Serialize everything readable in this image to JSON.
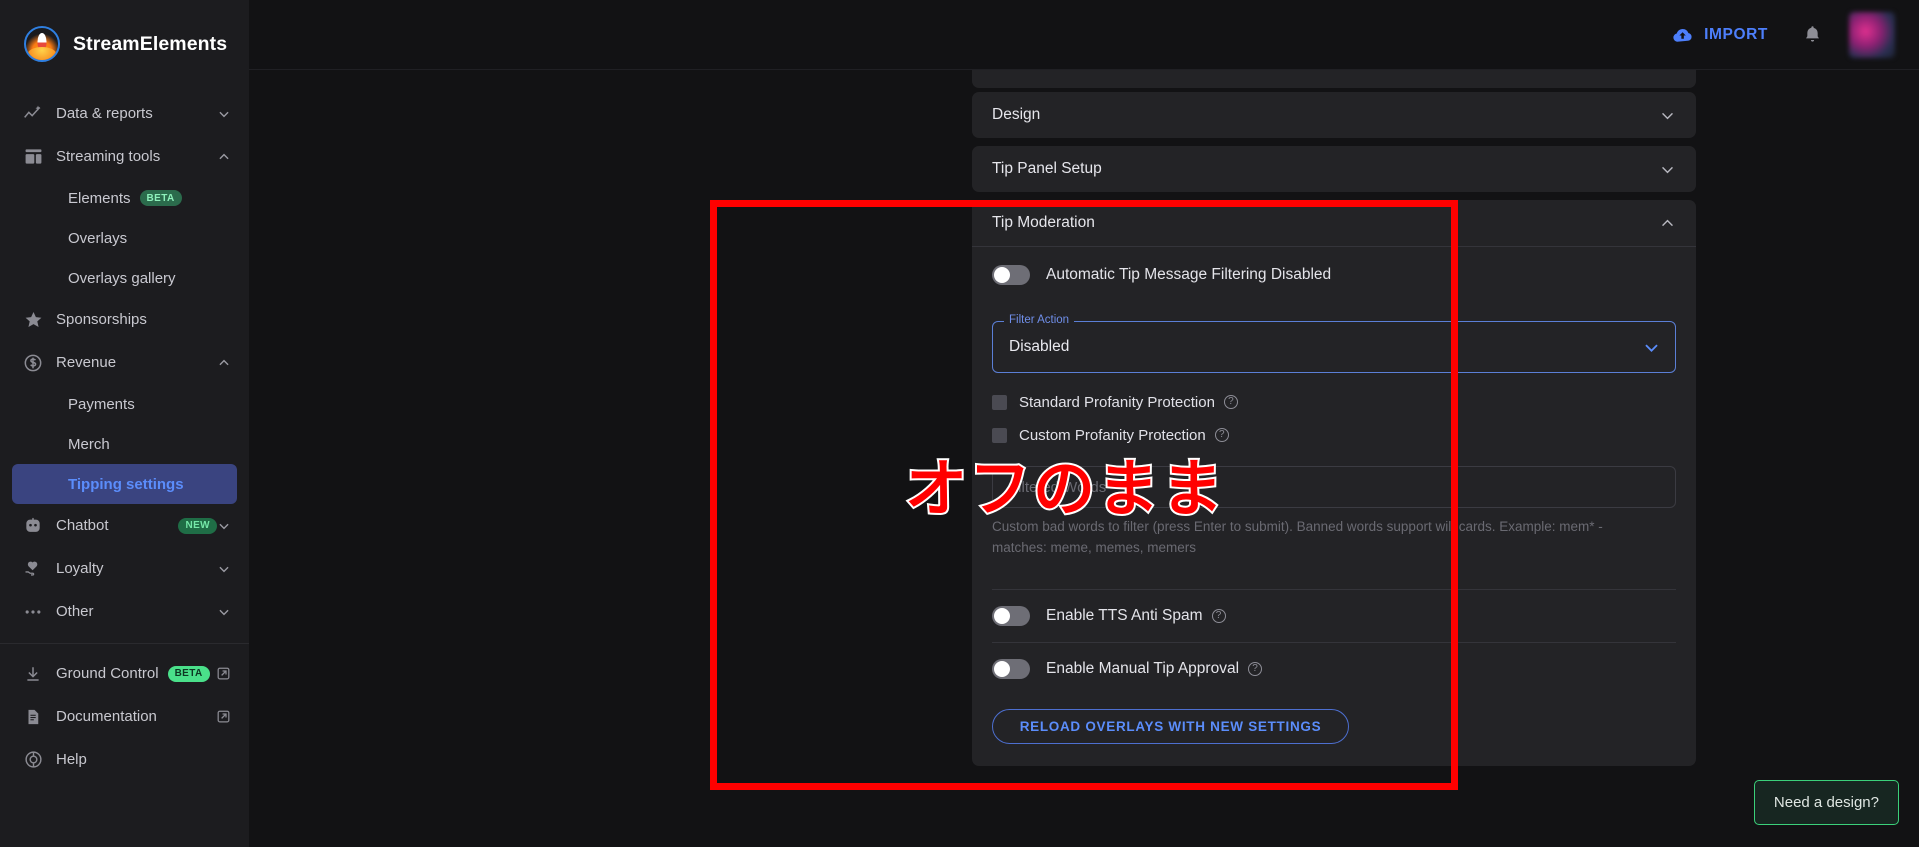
{
  "brand": {
    "name": "StreamElements",
    "logo_icon": "rocket-logo-icon"
  },
  "sidebar": {
    "groups": [
      {
        "label": "Data & reports",
        "icon": "analytics-icon",
        "chevron": "chevron-down-icon"
      },
      {
        "label": "Streaming tools",
        "icon": "stream-tools-icon",
        "chevron": "chevron-up-icon"
      }
    ],
    "streaming_tools_children": [
      {
        "label": "Elements",
        "badge": "BETA"
      },
      {
        "label": "Overlays",
        "badge": ""
      },
      {
        "label": "Overlays gallery",
        "badge": ""
      }
    ],
    "sponsorships": {
      "label": "Sponsorships",
      "icon": "star-icon"
    },
    "revenue": {
      "label": "Revenue",
      "icon": "dollar-circle-icon",
      "chevron": "chevron-up-icon"
    },
    "revenue_children": [
      {
        "label": "Payments",
        "active": false
      },
      {
        "label": "Merch",
        "active": false
      },
      {
        "label": "Tipping settings",
        "active": true
      }
    ],
    "chatbot": {
      "label": "Chatbot",
      "icon": "robot-icon",
      "badge": "NEW",
      "chevron": "chevron-down-icon"
    },
    "loyalty": {
      "label": "Loyalty",
      "icon": "heart-hand-icon",
      "chevron": "chevron-down-icon"
    },
    "other": {
      "label": "Other",
      "icon": "ellipsis-icon",
      "chevron": "chevron-down-icon"
    },
    "footer": [
      {
        "label": "Ground Control",
        "icon": "download-icon",
        "badge": "BETA",
        "external": true
      },
      {
        "label": "Documentation",
        "icon": "document-icon",
        "badge": "",
        "external": true
      },
      {
        "label": "Help",
        "icon": "help-circle-icon",
        "badge": "",
        "external": false
      }
    ]
  },
  "topbar": {
    "import_label": "IMPORT",
    "import_icon": "cloud-upload-icon",
    "bell_icon": "bell-icon",
    "avatar_icon": "user-avatar"
  },
  "panels": {
    "design": {
      "title": "Design",
      "chevron": "chevron-down-icon"
    },
    "tip_panel_setup": {
      "title": "Tip Panel Setup",
      "chevron": "chevron-down-icon"
    },
    "tip_moderation": {
      "title": "Tip Moderation",
      "chevron": "chevron-up-icon"
    }
  },
  "tip_moderation": {
    "auto_filter": {
      "label": "Automatic Tip Message Filtering Disabled",
      "state": "off"
    },
    "filter_action": {
      "legend": "Filter Action",
      "value": "Disabled",
      "chevron": "chevron-down-icon"
    },
    "standard_profanity": {
      "label": "Standard Profanity Protection",
      "checked": false,
      "help_icon": "question-mark-icon"
    },
    "custom_profanity": {
      "label": "Custom Profanity Protection",
      "checked": false,
      "help_icon": "question-mark-icon"
    },
    "filtered_words": {
      "placeholder": "Filtered Words",
      "value": ""
    },
    "filtered_words_helper": "Custom bad words to filter (press Enter to submit). Banned words support wildcards. Example: mem* - matches: meme, memes, memers",
    "tts_anti_spam": {
      "label": "Enable TTS Anti Spam",
      "state": "off",
      "help_icon": "question-mark-icon"
    },
    "manual_tip_approval": {
      "label": "Enable Manual Tip Approval",
      "state": "off",
      "help_icon": "question-mark-icon"
    },
    "reload_button": "RELOAD OVERLAYS WITH NEW SETTINGS"
  },
  "annotations": {
    "highlight_color": "#ff0000",
    "note_text": "オフのまま"
  },
  "need_design": {
    "label": "Need a design?",
    "accent": "#3bd07a"
  }
}
